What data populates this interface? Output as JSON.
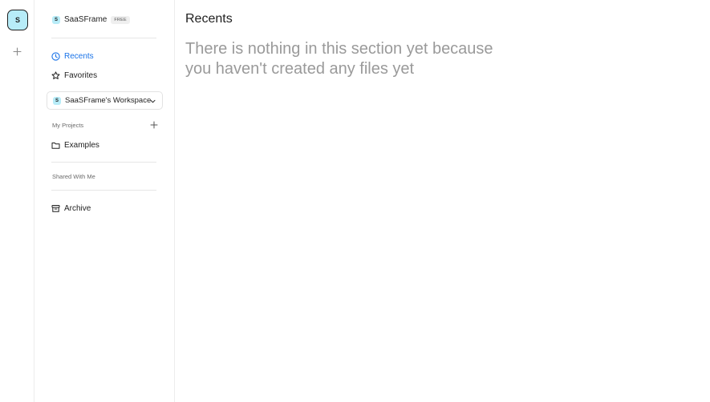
{
  "rail": {
    "avatar_letter": "S",
    "add_icon": "plus-icon"
  },
  "sidebar": {
    "brand": {
      "badge_letter": "S",
      "name": "SaaSFrame",
      "plan": "FREE"
    },
    "nav": [
      {
        "label": "Recents",
        "icon": "clock-icon",
        "active": true
      },
      {
        "label": "Favorites",
        "icon": "star-icon",
        "active": false
      }
    ],
    "workspace": {
      "badge_letter": "S",
      "name": "SaaSFrame's Workspace",
      "icon": "chevron-down-icon"
    },
    "my_projects": {
      "label": "My Projects",
      "add_icon": "plus-icon",
      "items": [
        {
          "label": "Examples",
          "icon": "folder-icon"
        }
      ]
    },
    "shared": {
      "label": "Shared With Me"
    },
    "archive": {
      "label": "Archive",
      "icon": "archive-icon"
    }
  },
  "main": {
    "title": "Recents",
    "empty_message": "There is nothing in this section yet because you haven't created any files yet"
  },
  "colors": {
    "accent": "#1a73e8",
    "badge_bg": "#b7ecf8",
    "muted_text": "#9a9a9a"
  }
}
